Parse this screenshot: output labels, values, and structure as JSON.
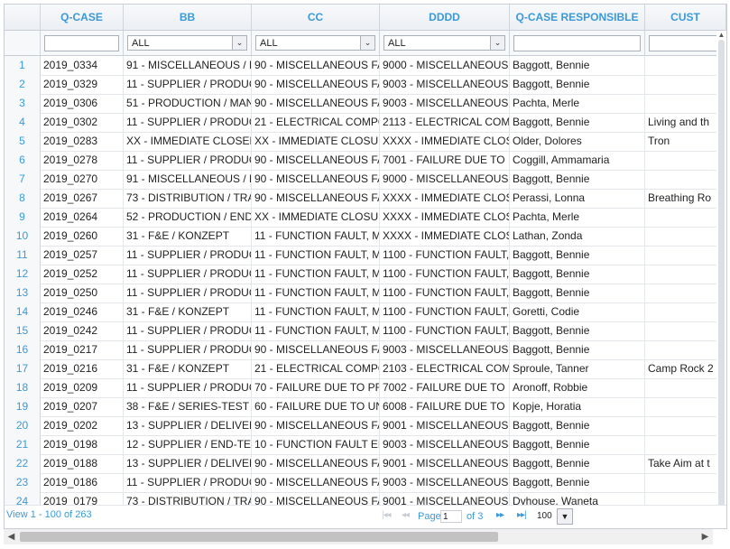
{
  "columns": [
    {
      "key": "rn",
      "label": ""
    },
    {
      "key": "qcase",
      "label": "Q-CASE"
    },
    {
      "key": "bb",
      "label": "BB"
    },
    {
      "key": "cc",
      "label": "CC"
    },
    {
      "key": "dddd",
      "label": "DDDD"
    },
    {
      "key": "resp",
      "label": "Q-CASE RESPONSIBLE"
    },
    {
      "key": "cust",
      "label": "CUST"
    }
  ],
  "filters": {
    "bb": "ALL",
    "cc": "ALL",
    "dddd": "ALL"
  },
  "rows": [
    [
      "1",
      "2019_0334",
      "91 - MISCELLANEOUS / M",
      "90 - MISCELLANEOUS FA",
      "9000 - MISCELLANEOUS",
      "Baggott, Bennie",
      ""
    ],
    [
      "2",
      "2019_0329",
      "11 - SUPPLIER / PRODUC",
      "90 - MISCELLANEOUS FA",
      "9003 - MISCELLANEOUS",
      "Baggott, Bennie",
      ""
    ],
    [
      "3",
      "2019_0306",
      "51 - PRODUCTION / MAN",
      "90 - MISCELLANEOUS FA",
      "9003 - MISCELLANEOUS",
      "Pachta, Merle",
      ""
    ],
    [
      "4",
      "2019_0302",
      "11 - SUPPLIER / PRODUC",
      "21 - ELECTRICAL COMPO",
      "2113 - ELECTRICAL COM",
      "Baggott, Bennie",
      "Living and th"
    ],
    [
      "5",
      "2019_0283",
      "XX - IMMEDIATE CLOSED",
      "XX - IMMEDIATE CLOSUR",
      "XXXX - IMMEDIATE CLOSU",
      "Older, Dolores",
      "Tron"
    ],
    [
      "6",
      "2019_0278",
      "11 - SUPPLIER / PRODUC",
      "90 - MISCELLANEOUS FA",
      "7001 - FAILURE DUE TO",
      "Coggill, Ammamaria",
      ""
    ],
    [
      "7",
      "2019_0270",
      "91 - MISCELLANEOUS / M",
      "90 - MISCELLANEOUS FA",
      "9000 - MISCELLANEOUS",
      "Baggott, Bennie",
      ""
    ],
    [
      "8",
      "2019_0267",
      "73 - DISTRIBUTION / TRA",
      "90 - MISCELLANEOUS FA",
      "XXXX - IMMEDIATE CLOSU",
      "Perassi, Lonna",
      "Breathing Ro"
    ],
    [
      "9",
      "2019_0264",
      "52 - PRODUCTION / END",
      "XX - IMMEDIATE CLOSUR",
      "XXXX - IMMEDIATE CLOSU",
      "Pachta, Merle",
      ""
    ],
    [
      "10",
      "2019_0260",
      "31 - F&E / KONZEPT",
      "11 - FUNCTION FAULT, MI",
      "XXXX - IMMEDIATE CLOSU",
      "Lathan, Zonda",
      ""
    ],
    [
      "11",
      "2019_0257",
      "11 - SUPPLIER / PRODUC",
      "11 - FUNCTION FAULT, MI",
      "1100 - FUNCTION FAULT,",
      "Baggott, Bennie",
      ""
    ],
    [
      "12",
      "2019_0252",
      "11 - SUPPLIER / PRODUC",
      "11 - FUNCTION FAULT, MI",
      "1100 - FUNCTION FAULT,",
      "Baggott, Bennie",
      ""
    ],
    [
      "13",
      "2019_0250",
      "11 - SUPPLIER / PRODUC",
      "11 - FUNCTION FAULT, MI",
      "1100 - FUNCTION FAULT,",
      "Baggott, Bennie",
      ""
    ],
    [
      "14",
      "2019_0246",
      "31 - F&E / KONZEPT",
      "11 - FUNCTION FAULT, MI",
      "1100 - FUNCTION FAULT,",
      "Goretti, Codie",
      ""
    ],
    [
      "15",
      "2019_0242",
      "11 - SUPPLIER / PRODUC",
      "11 - FUNCTION FAULT, MI",
      "1100 - FUNCTION FAULT,",
      "Baggott, Bennie",
      ""
    ],
    [
      "16",
      "2019_0217",
      "11 - SUPPLIER / PRODUC",
      "90 - MISCELLANEOUS FA",
      "9003 - MISCELLANEOUS",
      "Baggott, Bennie",
      ""
    ],
    [
      "17",
      "2019_0216",
      "31 - F&E / KONZEPT",
      "21 - ELECTRICAL COMPO",
      "2103 - ELECTRICAL COM",
      "Sproule, Tanner",
      "Camp Rock 2"
    ],
    [
      "18",
      "2019_0209",
      "11 - SUPPLIER / PRODUC",
      "70 - FAILURE DUE TO PR",
      "7002 - FAILURE DUE TO",
      "Aronoff, Robbie",
      ""
    ],
    [
      "19",
      "2019_0207",
      "38 - F&E / SERIES-TEST",
      "60 - FAILURE DUE TO UN",
      "6008 - FAILURE DUE TO",
      "Kopje, Horatia",
      ""
    ],
    [
      "20",
      "2019_0202",
      "13 - SUPPLIER / DELIVER",
      "90 - MISCELLANEOUS FA",
      "9001 - MISCELLANEOUS",
      "Baggott, Bennie",
      ""
    ],
    [
      "21",
      "2019_0198",
      "12 - SUPPLIER / END-TE",
      "10 - FUNCTION FAULT EL",
      "9003 - MISCELLANEOUS",
      "Baggott, Bennie",
      ""
    ],
    [
      "22",
      "2019_0188",
      "13 - SUPPLIER / DELIVER",
      "90 - MISCELLANEOUS FA",
      "9001 - MISCELLANEOUS",
      "Baggott, Bennie",
      "Take Aim at t"
    ],
    [
      "23",
      "2019_0186",
      "11 - SUPPLIER / PRODUC",
      "90 - MISCELLANEOUS FA",
      "9003 - MISCELLANEOUS",
      "Baggott, Bennie",
      ""
    ],
    [
      "24",
      "2019_0179",
      "73 - DISTRIBUTION / TRA",
      "90 - MISCELLANEOUS FA",
      "9001 - MISCELLANEOUS",
      "Dyhouse, Waneta",
      ""
    ]
  ],
  "pager": {
    "view_text": "View 1 - 100 of 263",
    "page_label": "Page",
    "page_value": "1",
    "of_text": "of 3",
    "page_size": "100"
  },
  "icons": {
    "first": "first-page-icon",
    "prev": "prev-page-icon",
    "next": "next-page-icon",
    "last": "last-page-icon",
    "dropdown": "chevron-down-icon"
  }
}
